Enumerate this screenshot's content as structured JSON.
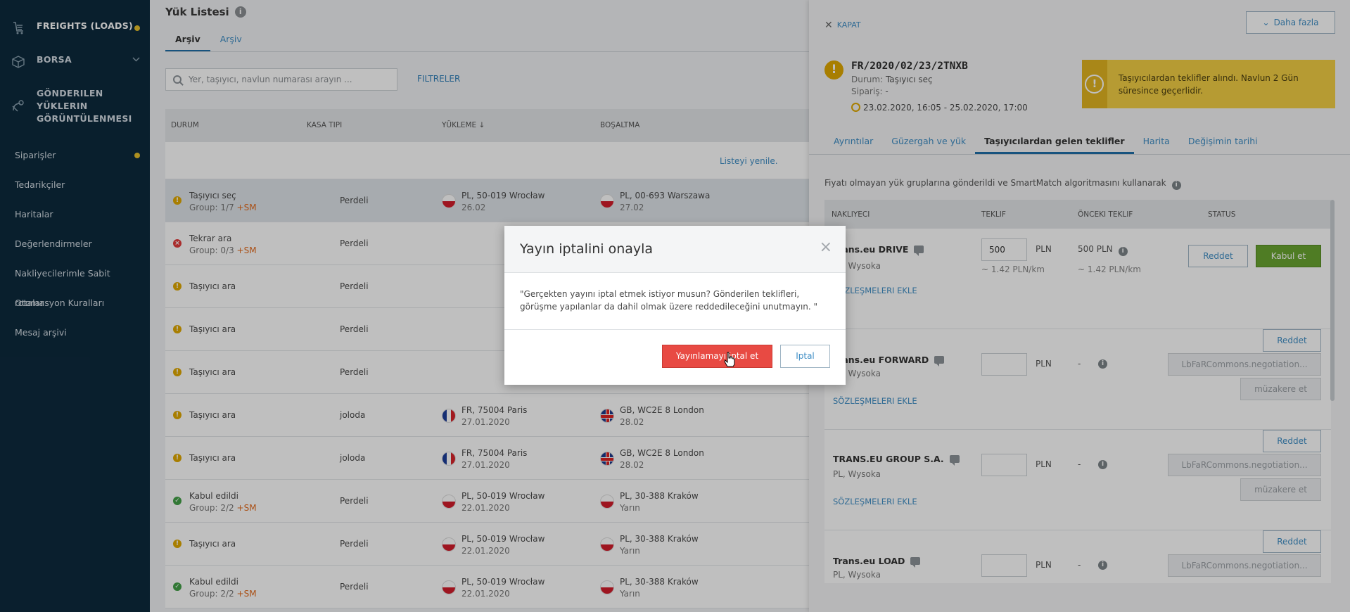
{
  "sidebar": {
    "top_items": [
      {
        "label": "FREIGHTS (LOADS)",
        "icon": "freight-cart-icon"
      },
      {
        "label": "BORSA",
        "icon": "box-icon"
      },
      {
        "label": "GÖNDERILEN YÜKLERIN GÖRÜNTÜLENMESI",
        "icon": "satellite-icon"
      }
    ],
    "links": [
      "Siparişler",
      "Tedarikçiler",
      "Haritalar",
      "Değerlendirmeler",
      "Nakliyecilerimle Sabit rotalar",
      "Otomasyon Kuralları",
      "Mesaj arşivi"
    ],
    "dot_color": "#e7c12b"
  },
  "main": {
    "title": "Yük Listesi",
    "tabs": [
      "Arşiv",
      "Arşiv"
    ],
    "search_placeholder": "Yer, taşıyıcı, navlun numarası arayın ...",
    "filters_label": "FILTRELER",
    "columns": [
      "DURUM",
      "KASA TIPI",
      "YÜKLEME ↓",
      "BOŞALTMA"
    ],
    "refresh": "Listeyi yenile.",
    "rows": [
      {
        "status": "Taşıyıcı seç",
        "group": "Group: 1/7",
        "sm": "+SM",
        "kasa": "Perdeli",
        "load_city": "PL, 50-019 Wrocław",
        "load_date": "26.02",
        "unload_city": "PL, 00-693 Warszawa",
        "unload_date": "27.02"
      },
      {
        "status": "Tekrar ara",
        "group": "Group: 0/3",
        "sm": "+SM",
        "kasa": "Perdeli"
      },
      {
        "status": "Taşıyıcı ara",
        "kasa": "Perdeli"
      },
      {
        "status": "Taşıyıcı ara",
        "kasa": "Perdeli"
      },
      {
        "status": "Taşıyıcı ara",
        "kasa": "Perdeli"
      },
      {
        "status": "Taşıyıcı ara",
        "kasa": "joloda",
        "load_city": "FR, 75004 Paris",
        "load_date": "27.01.2020",
        "unload_city": "GB, WC2E 8 London",
        "unload_date": "28.02"
      },
      {
        "status": "Taşıyıcı ara",
        "kasa": "joloda",
        "load_city": "FR, 75004 Paris",
        "load_date": "27.01.2020",
        "unload_city": "GB, WC2E 8 London",
        "unload_date": "28.02"
      },
      {
        "status": "Kabul edildi",
        "group": "Group: 2/2",
        "sm": "+SM",
        "kasa": "Perdeli",
        "load_city": "PL, 50-019 Wrocław",
        "load_date": "22.01.2020",
        "unload_city": "PL, 30-388 Kraków",
        "unload_date": "Yarın"
      },
      {
        "status": "Taşıyıcı ara",
        "kasa": "Perdeli",
        "load_city": "PL, 50-019 Wrocław",
        "load_date": "22.01.2020",
        "unload_city": "PL, 30-388 Kraków",
        "unload_date": "Yarın"
      },
      {
        "status": "Kabul edildi",
        "group": "Group: 2/2",
        "sm": "+SM",
        "kasa": "Perdeli",
        "load_city": "PL, 50-019 Wrocław",
        "load_date": "22.01.2020",
        "unload_city": "PL, 30-388 Kraków",
        "unload_date": "Yarın"
      }
    ]
  },
  "panel": {
    "close_label": "KAPAT",
    "more_label": "Daha fazla",
    "order_id": "FR/2020/02/23/2TNXB",
    "status_key": "Durum:",
    "status_val": "Taşıyıcı seç",
    "order_key": "Sipariş:",
    "order_val": "-",
    "dates": "23.02.2020, 16:05 - 25.02.2020, 17:00",
    "notice": "Taşıyıcılardan teklifler alındı. Navlun 2 Gün süresince geçerlidir.",
    "tabs": [
      "Ayrıntılar",
      "Güzergah ve yük",
      "Taşıyıcılardan gelen teklifler",
      "Harita",
      "Değişimin tarihi"
    ],
    "sent_info": "Fiyatı olmayan yük gruplarına gönderildi ve SmartMatch algoritmasını kullanarak",
    "columns": [
      "NAKLIYECI",
      "TEKLIF",
      "ÖNCEKI TEKLIF",
      "STATUS"
    ],
    "currency": "PLN",
    "contract_label": "SÖZLEŞMELERI EKLE",
    "reject": "Reddet",
    "accept": "Kabul et",
    "negotiation": "LbFaRCommons.negotiation...",
    "negotiate": "müzakere et",
    "carriers": [
      {
        "name": "Trans.eu DRIVE",
        "loc": "PL, Wysoka",
        "price": "500",
        "perkm": "~ 1.42 PLN/km",
        "prev": "500 PLN",
        "prev_perkm": "~ 1.42 PLN/km"
      },
      {
        "name": "Trans.eu FORWARD",
        "loc": "PL, Wysoka",
        "price": "",
        "prev": "-"
      },
      {
        "name": "TRANS.EU GROUP S.A.",
        "loc": "PL, Wysoka",
        "price": "",
        "prev": "-"
      },
      {
        "name": "Trans.eu LOAD",
        "loc": "PL, Wysoka",
        "price": "",
        "prev": "-"
      }
    ]
  },
  "modal": {
    "title": "Yayın iptalini onayla",
    "body": "\"Gerçekten yayını iptal etmek istiyor musun? Gönderilen teklifleri, görüşme yapılanlar da dahil olmak üzere reddedileceğini unutmayın. \"",
    "confirm": "Yayınlamayı iptal et",
    "cancel": "Iptal"
  }
}
